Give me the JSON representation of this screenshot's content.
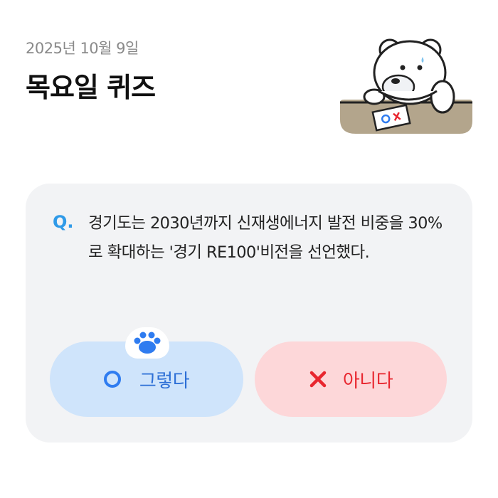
{
  "header": {
    "date": "2025년 10월 9일",
    "title": "목요일 퀴즈"
  },
  "quiz": {
    "q_label": "Q.",
    "question": "경기도는 2030년까지 신재생에너지 발전 비중을 30%로 확대하는 '경기 RE100'비전을 선언했다.",
    "answers": {
      "yes_label": "그렇다",
      "no_label": "아니다"
    }
  },
  "icons": {
    "mascot": "bear-holding-ox-card-icon",
    "yes": "circle-o-icon",
    "no": "x-icon",
    "hint": "paw-icon"
  },
  "colors": {
    "accent_blue": "#2f9ae8",
    "yes_bg": "#cfe4fb",
    "no_bg": "#fdd7d9",
    "no_text": "#e8262f",
    "card_bg": "#f2f3f5"
  }
}
